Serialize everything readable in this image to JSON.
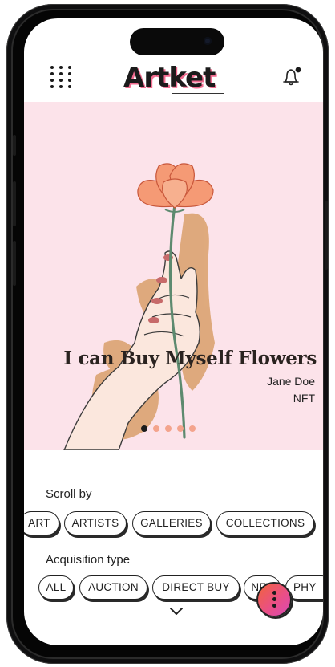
{
  "app": {
    "logo_text": "Artket",
    "accent_color": "#f06b8f",
    "menu_icon": "grid-dots-icon",
    "notification_icon": "bell-icon"
  },
  "hero": {
    "title": "I can Buy Myself Flowers",
    "author": "Jane Doe",
    "type": "NFT",
    "slide_count": 5,
    "active_slide": 1,
    "background_color": "#fce3ea"
  },
  "scroll_by": {
    "label": "Scroll by",
    "options": [
      "ART",
      "ARTISTS",
      "GALLERIES",
      "COLLECTIONS"
    ]
  },
  "acquisition": {
    "label": "Acquisition type",
    "options": [
      "ALL",
      "AUCTION",
      "DIRECT BUY",
      "NFT",
      "PHY"
    ]
  },
  "expand_icon": "chevron-down-icon",
  "fab_icon": "vertical-dots-icon"
}
